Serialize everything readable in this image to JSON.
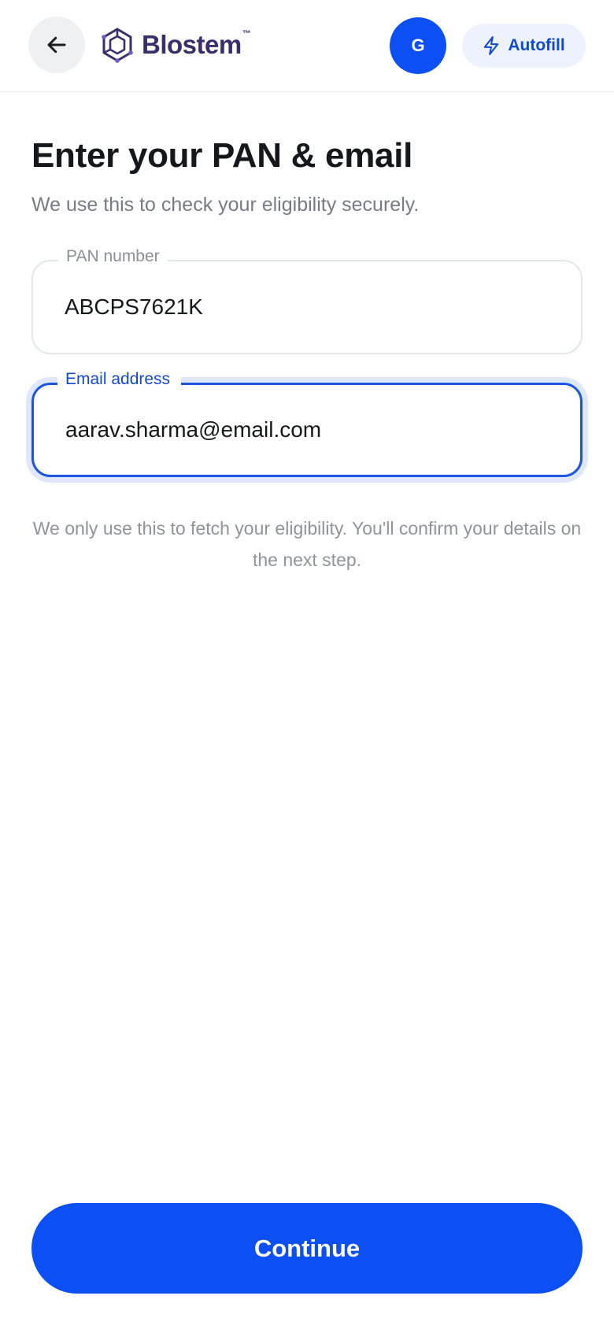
{
  "header": {
    "back_icon": "arrow-left-icon",
    "brand_name": "Blostem",
    "brand_tm": "™",
    "avatar_initial": "G",
    "autofill_label": "Autofill",
    "autofill_icon": "lightning-bolt-icon"
  },
  "main": {
    "title": "Enter your PAN & email",
    "subtitle": "We use this to check your eligibility securely.",
    "pan_field": {
      "label": "PAN number",
      "value": "ABCPS7621K"
    },
    "email_field": {
      "label": "Email address",
      "value": "aarav.sharma@email.com"
    },
    "note": "We only use this to fetch your eligibility. You'll confirm your details on the next step."
  },
  "footer": {
    "continue_label": "Continue"
  },
  "colors": {
    "primary": "#0b4ff5",
    "brand": "#3a2f6b",
    "focus_border": "#1b55e0",
    "muted_text": "#8f949c"
  }
}
